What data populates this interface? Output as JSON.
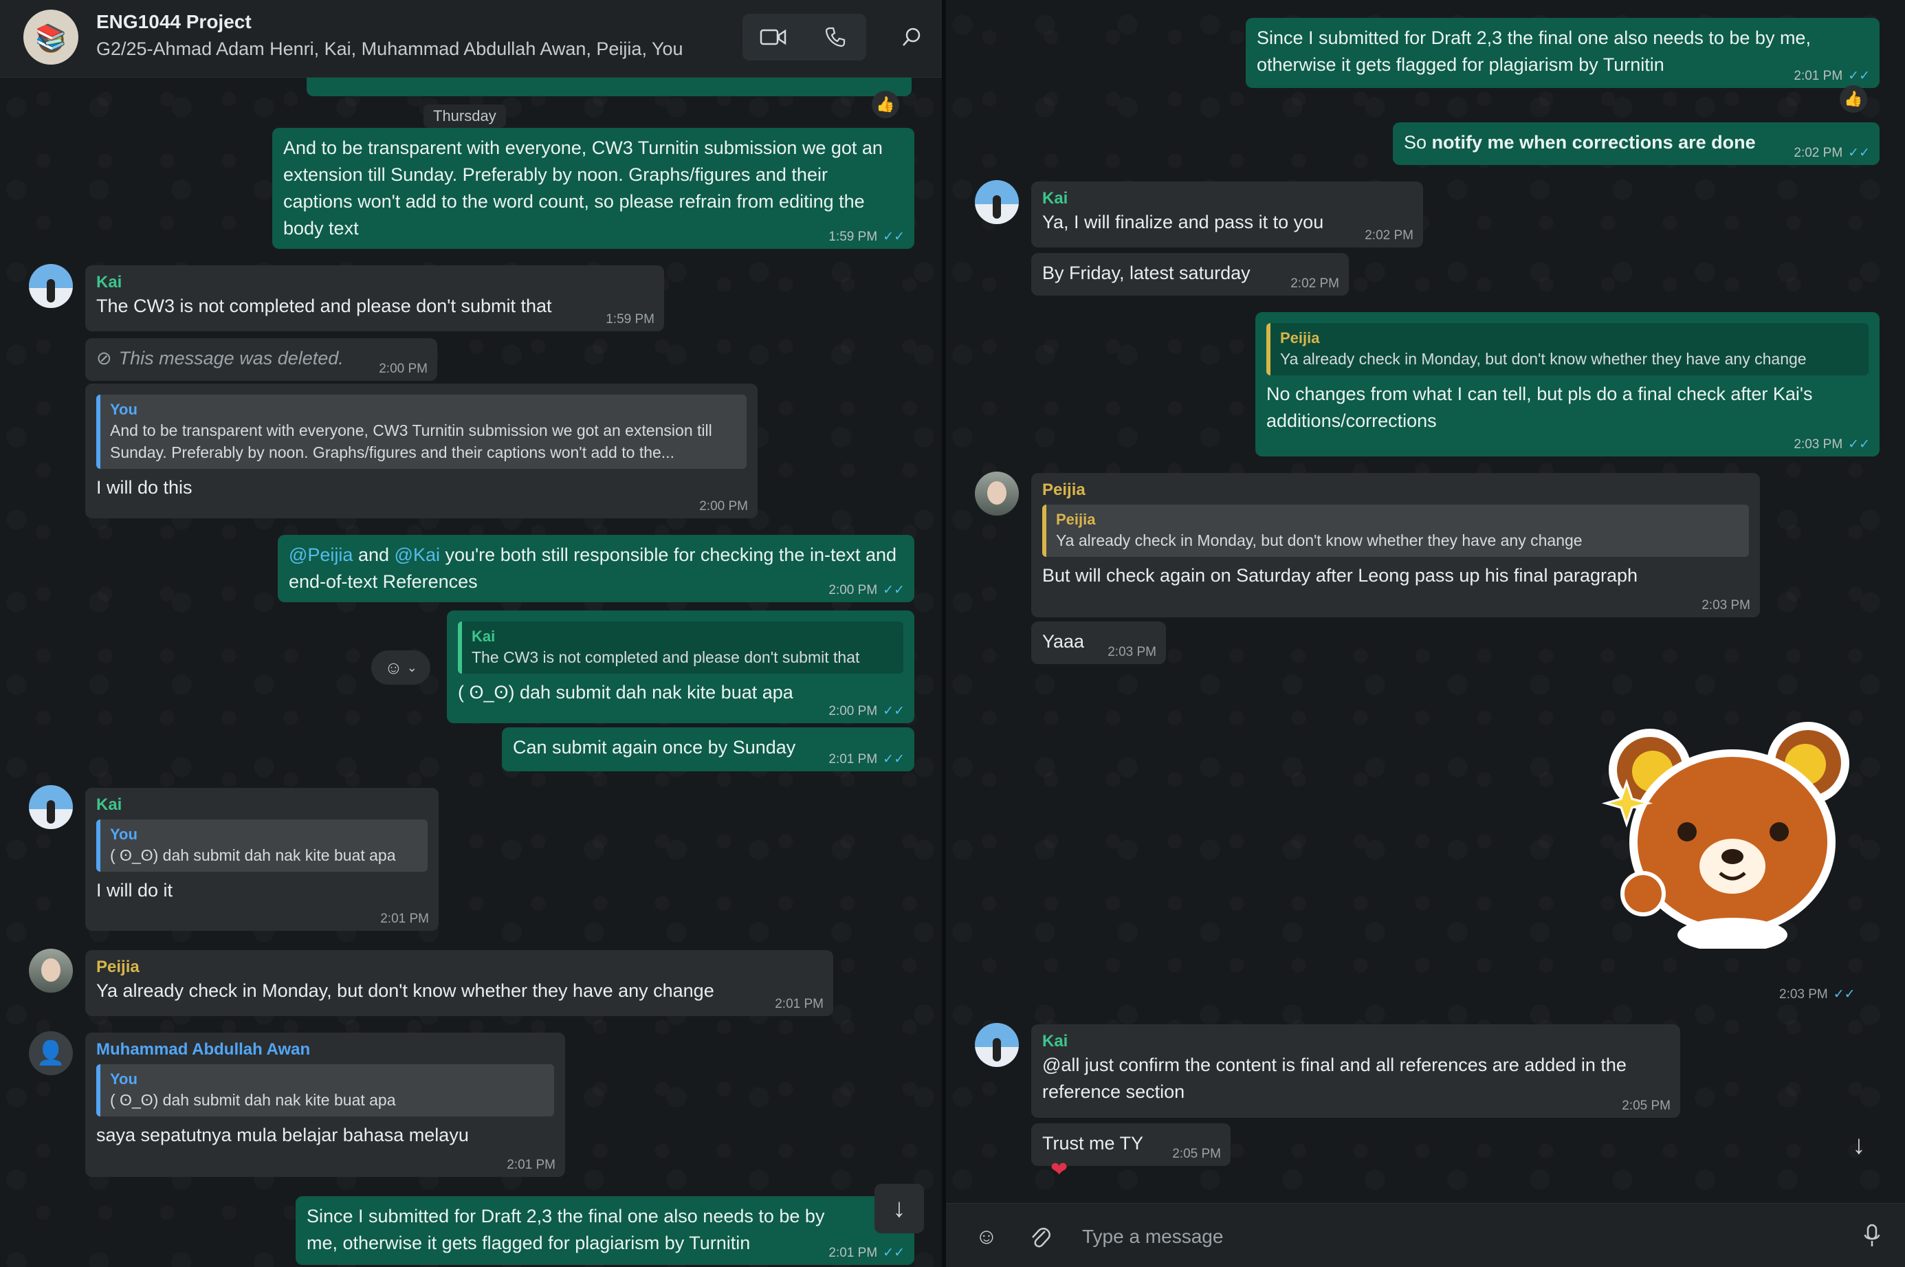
{
  "header": {
    "title": "ENG1044 Project",
    "subtitle": "G2/25-Ahmad Adam Henri, Kai, Muhammad Abdullah Awan, Peijia, You"
  },
  "day_chip": "Thursday",
  "left_messages": {
    "m1": {
      "text": "And to be transparent with everyone, CW3 Turnitin submission we got an extension till Sunday. Preferably by noon. Graphs/figures and their captions won't add to the word count, so please refrain from editing the body text",
      "time": "1:59 PM"
    },
    "m2": {
      "sender": "Kai",
      "text": "The CW3 is not completed and please don't submit that",
      "time": "1:59 PM"
    },
    "m3": {
      "text": "This message was deleted.",
      "time": "2:00 PM"
    },
    "m4": {
      "quote_name": "You",
      "quote_text": "And to be transparent with everyone, CW3 Turnitin submission we got an extension till Sunday. Preferably by noon. Graphs/figures and their captions won't add to the...",
      "text": "I will do this",
      "time": "2:00 PM"
    },
    "m5": {
      "mention1": "@Peijia",
      "and": "and",
      "mention2": "@Kai",
      "text": "you're both still responsible for checking the in-text and end-of-text References",
      "time": "2:00 PM"
    },
    "m6": {
      "quote_name": "Kai",
      "quote_text": "The CW3 is not completed and please don't submit that",
      "text": "( ʘ_ʘ) dah submit dah nak kite buat apa",
      "time": "2:00 PM"
    },
    "m7": {
      "text": "Can submit again once by Sunday",
      "time": "2:01 PM"
    },
    "m8": {
      "sender": "Kai",
      "quote_name": "You",
      "quote_text": "( ʘ_ʘ) dah submit dah nak kite buat apa",
      "text": "I will do it",
      "time": "2:01 PM"
    },
    "m9": {
      "sender": "Peijia",
      "text": "Ya already check in Monday, but don't know whether they have any change",
      "time": "2:01 PM"
    },
    "m10": {
      "sender": "Muhammad Abdullah Awan",
      "quote_name": "You",
      "quote_text": "( ʘ_ʘ) dah submit dah nak kite buat apa",
      "text": "saya sepatutnya mula belajar bahasa melayu",
      "time": "2:01 PM"
    },
    "m11": {
      "text": "Since I submitted for Draft 2,3 the final one also needs to be by me, otherwise it gets flagged for plagiarism by Turnitin",
      "time": "2:01 PM"
    }
  },
  "right_messages": {
    "r1": {
      "text": "Since I submitted for Draft 2,3 the final one also needs to be by me, otherwise it gets flagged for plagiarism by Turnitin",
      "time": "2:01 PM"
    },
    "r2": {
      "text_plain": "So",
      "text_bold": "notify me when corrections are done",
      "time": "2:02 PM"
    },
    "r3": {
      "sender": "Kai",
      "text": "Ya, I will finalize and pass it to you",
      "time": "2:02 PM"
    },
    "r4": {
      "text": "By Friday, latest saturday",
      "time": "2:02 PM"
    },
    "r5": {
      "quote_name": "Peijia",
      "quote_text": "Ya already check in Monday, but don't know whether they have any change",
      "text": "No changes from what I can tell, but pls do a final check after Kai's additions/corrections",
      "time": "2:03 PM"
    },
    "r6": {
      "sender": "Peijia",
      "quote_name": "Peijia",
      "quote_text": "Ya already check in Monday, but don't know whether they have any change",
      "text": "But will check again on Saturday after Leong pass up his final paragraph",
      "time": "2:03 PM"
    },
    "r7": {
      "text": "Yaaa",
      "time": "2:03 PM"
    },
    "r8": {
      "time": "2:03 PM"
    },
    "r9": {
      "sender": "Kai",
      "text": "@all just confirm the content is final and all references are added in the reference section",
      "time": "2:05 PM"
    },
    "r10": {
      "text": "Trust me TY",
      "time": "2:05 PM",
      "reaction": "❤"
    }
  },
  "compose": {
    "placeholder": "Type a message"
  },
  "icons": {
    "video": "video-call-icon",
    "voice": "voice-call-icon",
    "search": "search-icon",
    "emoji": "emoji-icon",
    "attach": "attach-icon",
    "mic": "mic-icon",
    "scroll": "arrow-down-icon"
  },
  "colors": {
    "outgoing_bubble": "#0e5c4a",
    "incoming_bubble": "#2a2e31",
    "kai_name": "#3ec58c",
    "peijia_name": "#d9b64a",
    "awan_name": "#53a6f5",
    "read_ticks": "#53bdeb"
  }
}
